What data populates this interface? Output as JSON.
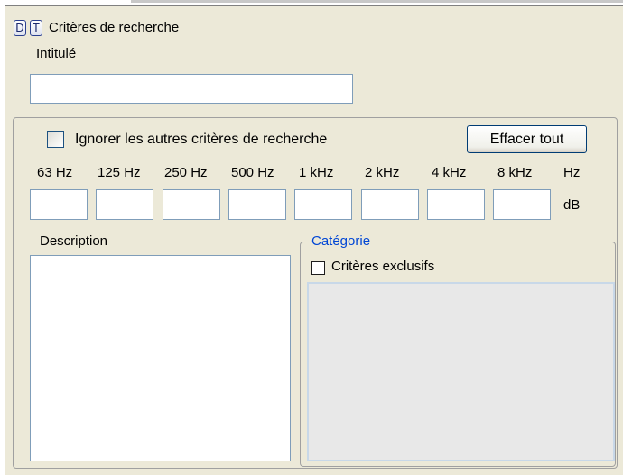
{
  "header": {
    "btn_d": "D",
    "btn_t": "T",
    "title": "Critères de recherche"
  },
  "intitule": {
    "label": "Intitulé",
    "value": ""
  },
  "options": {
    "ignore_label": "Ignorer les autres critères de recherche",
    "ignore_checked": false,
    "clear_button": "Effacer tout"
  },
  "frequencies": {
    "bands": [
      "63 Hz",
      "125 Hz",
      "250 Hz",
      "500 Hz",
      "1 kHz",
      "2 kHz",
      "4 kHz",
      "8 kHz"
    ],
    "unit_hz": "Hz",
    "unit_db": "dB",
    "values": [
      "",
      "",
      "",
      "",
      "",
      "",
      "",
      ""
    ]
  },
  "description": {
    "label": "Description",
    "value": ""
  },
  "categorie": {
    "legend": "Catégorie",
    "exclusive_label": "Critères exclusifs",
    "exclusive_checked": false
  },
  "colors": {
    "panel_bg": "#ece9d8",
    "field_border": "#7f9db9",
    "legend_blue": "#0046d5"
  }
}
